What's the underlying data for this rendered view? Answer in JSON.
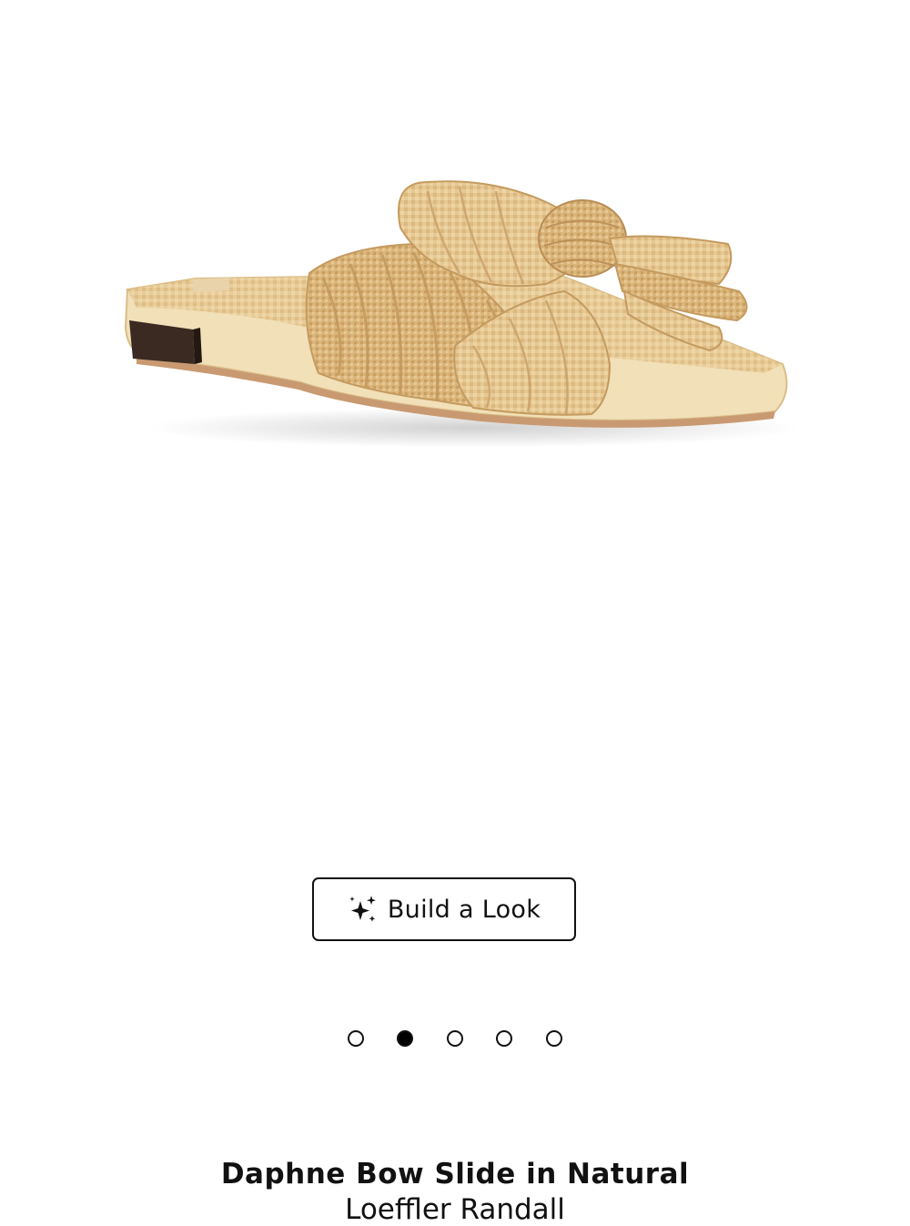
{
  "product": {
    "image_alt": "Daphne Bow Slide in Natural",
    "title": "Daphne Bow Slide in Natural",
    "brand": "Loeffler Randall"
  },
  "actions": {
    "build_look_label": "Build a Look",
    "build_look_icon": "sparkle-icon"
  },
  "carousel": {
    "total": 5,
    "active_index": 1
  },
  "colors": {
    "text": "#111111",
    "raffia_light": "#ecd3a0",
    "raffia_mid": "#dcbb82",
    "raffia_dark": "#c9a165",
    "heel": "#3a2a22"
  }
}
